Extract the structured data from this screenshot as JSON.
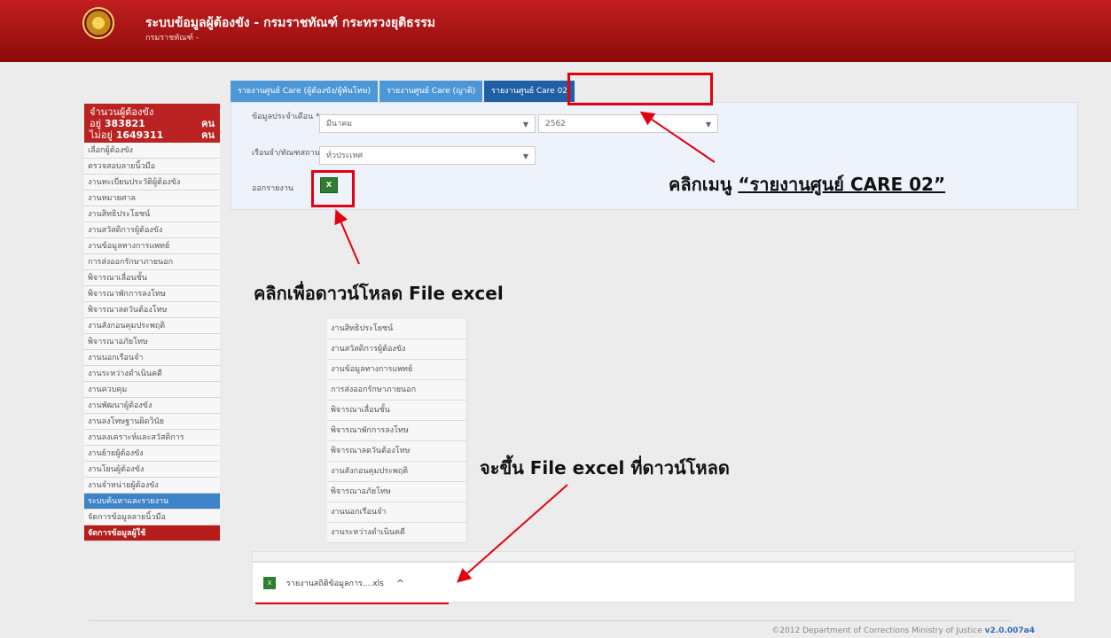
{
  "header": {
    "title": "ระบบข้อมูลผู้ต้องขัง - กรมราชทัณฑ์ กระทรวงยุติธรรม",
    "subtitle": "กรมราชทัณฑ์ -"
  },
  "sidebar": {
    "count_title": "จำนวนผู้ต้องขัง",
    "present_label": "อยู่",
    "present_value": "383821",
    "present_unit": "คน",
    "absent_label": "ไม่อยู่",
    "absent_value": "1649311",
    "absent_unit": "คน",
    "items": [
      "เลือกผู้ต้องขัง",
      "ตรวจสอบลายนิ้วมือ",
      "งานทะเบียนประวัติผู้ต้องขัง",
      "งานหมายศาล",
      "งานสิทธิประโยชน์",
      "งานสวัสดิการผู้ต้องขัง",
      "งานข้อมูลทางการแพทย์",
      "การส่งออกรักษาภายนอก",
      "พิจารณาเลื่อนชั้น",
      "พิจารณาพักการลงโทษ",
      "พิจารณาลดวันต้องโทษ",
      "งานสังกอนคุมประพฤติ",
      "พิจารณาอภัยโทษ",
      "งานนอกเรือนจำ",
      "งานระหว่างดำเนินคดี",
      "งานควบคุม",
      "งานพัฒนาผู้ต้องขัง",
      "งานลงโทษฐานผิดวินัย",
      "งานลงเคราะห์และสวัสดิการ",
      "งานย้ายผู้ต้องขัง",
      "งานโยนผู้ต้องขัง",
      "งานจำหน่ายผู้ต้องขัง",
      "ระบบค้นหาและรายงาน",
      "จัดการข้อมูลลายนิ้วมือ",
      "จัดการข้อมูลผู้ใช้"
    ]
  },
  "tabs": [
    "รายงานศูนย์ Care (ผู้ต้องขัง/ผู้พ้นโทษ)",
    "รายงานศูนย์ Care (ญาติ)",
    "รายงานศูนย์ Care 02"
  ],
  "form": {
    "month_label": "ข้อมูลประจำเดือน *",
    "month_value": "มีนาคม",
    "year_value": "2562",
    "prison_label": "เรือนจำ/ทัณฑสถาน",
    "prison_value": "ทั่วประเทศ",
    "export_label": "ออกรายงาน",
    "export_icon": "excel-icon"
  },
  "annotations": {
    "menu_prefix": "คลิกเมนู ",
    "menu_underlined": "“รายงานศูนย์ CARE 02”",
    "download": "คลิกเพื่อดาวน์โหลด File excel",
    "file": "จะขึ้น File excel ที่ดาวน์โหลด"
  },
  "float_menu": [
    "งานสิทธิประโยชน์",
    "งานสวัสดิการผู้ต้องขัง",
    "งานข้อมูลทางการแพทย์",
    "การส่งออกรักษาภายนอก",
    "พิจารณาเลื่อนชั้น",
    "พิจารณาพักการลงโทษ",
    "พิจารณาลดวันต้องโทษ",
    "งานสังกอนคุมประพฤติ",
    "พิจารณาอภัยโทษ",
    "งานนอกเรือนจำ",
    "งานระหว่างดำเนินคดี"
  ],
  "download": {
    "filename": "รายงานสถิติข้อมูลการ....xls",
    "chevron": "^"
  },
  "footer": {
    "copyright": "©2012 Department of Corrections Ministry of Justice",
    "version": "v2.0.007a4"
  },
  "colors": {
    "header": "#b21616",
    "accent_red": "#e3000f",
    "tab_blue": "#4e97d6",
    "tab_active": "#1f5fa5"
  }
}
